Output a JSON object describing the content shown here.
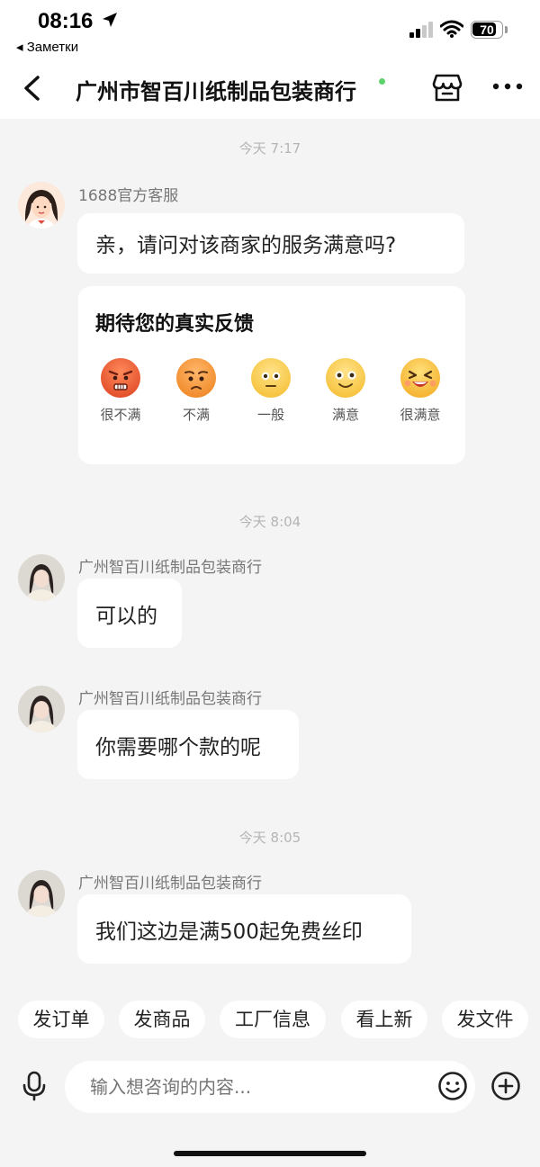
{
  "status_bar": {
    "time": "08:16",
    "back_app": "◂ Заметки",
    "battery": "70"
  },
  "nav": {
    "title": "广州市智百川纸制品包装商行"
  },
  "messages": [
    {
      "timestamp": "今天 7:17",
      "sender": "1688官方客服",
      "text": "亲，请问对该商家的服务满意吗?"
    },
    {
      "timestamp": "今天 8:04",
      "sender": "广州智百川纸制品包装商行",
      "text": "可以的"
    },
    {
      "sender": "广州智百川纸制品包装商行",
      "text": "你需要哪个款的呢"
    },
    {
      "timestamp": "今天 8:05",
      "sender": "广州智百川纸制品包装商行",
      "text": "我们这边是满500起免费丝印"
    }
  ],
  "feedback": {
    "title": "期待您的真实反馈",
    "options": [
      {
        "label": "很不满",
        "icon": "angry-face-icon"
      },
      {
        "label": "不满",
        "icon": "frown-face-icon"
      },
      {
        "label": "一般",
        "icon": "neutral-face-icon"
      },
      {
        "label": "满意",
        "icon": "smile-face-icon"
      },
      {
        "label": "很满意",
        "icon": "laughing-face-icon"
      }
    ]
  },
  "quick_actions": [
    "发订单",
    "发商品",
    "工厂信息",
    "看上新",
    "发文件"
  ],
  "input": {
    "placeholder": "输入想咨询的内容..."
  },
  "colors": {
    "background": "#f4f4f4",
    "online": "#5fd36b",
    "bubble": "#ffffff"
  }
}
